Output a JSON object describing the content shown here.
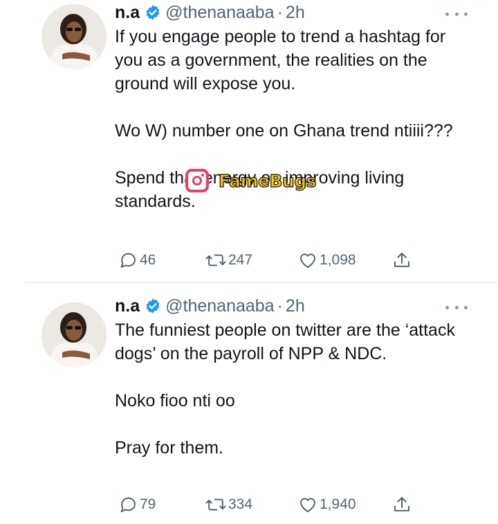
{
  "tweets": [
    {
      "name": "n.a",
      "handle": "@thenanaaba",
      "separator": "·",
      "time": "2h",
      "paragraphs": [
        "If you engage people to trend a hashtag for you as a government, the realities on the ground will expose you.",
        "",
        "Wo W) number one on Ghana trend ntiiii???",
        "",
        "Spend that energy on improving living standards."
      ],
      "replies": "46",
      "retweets": "247",
      "likes": "1,098"
    },
    {
      "name": "n.a",
      "handle": "@thenanaaba",
      "separator": "·",
      "time": "2h",
      "paragraphs": [
        "The funniest people on twitter are the ‘attack dogs’ on the payroll of NPP & NDC.",
        "",
        "Noko fioo nti oo",
        "",
        "Pray for them."
      ],
      "replies": "79",
      "retweets": "334",
      "likes": "1,940"
    }
  ],
  "watermark": {
    "icon": "instagram-icon",
    "text": "FameBugs"
  },
  "colors": {
    "verified": "#1d9bf0",
    "secondary_text": "#536471",
    "divider": "#e1e5e9"
  }
}
